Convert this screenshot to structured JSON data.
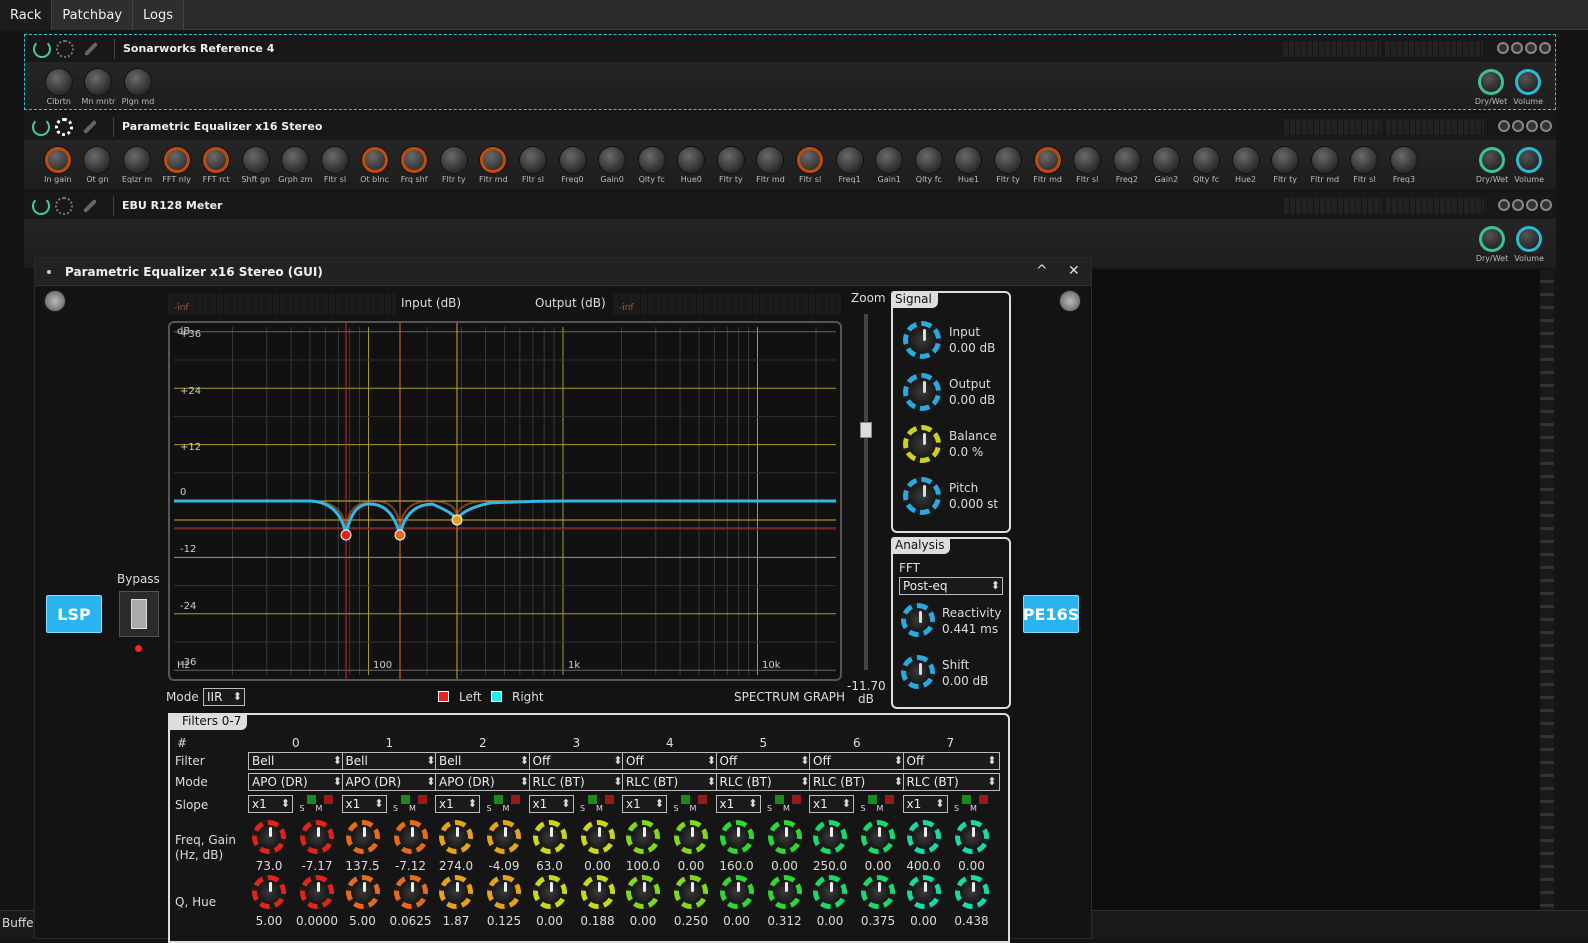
{
  "tabs": [
    "Rack",
    "Patchbay",
    "Logs"
  ],
  "plugins": [
    {
      "title": "Sonarworks Reference 4",
      "knobs": [
        "Clbrtn",
        "Mn mntr",
        "Plgn md"
      ]
    },
    {
      "title": "Parametric Equalizer x16 Stereo",
      "knobs": [
        "In gain",
        "Ot gn",
        "Eqlzr m",
        "FFT nly",
        "FFT rct",
        "Shft gn",
        "Grph zm",
        "Fltr sl",
        "Ot blnc",
        "Frq shf",
        "Fltr ty",
        "Fltr md",
        "Fltr sl",
        "Freq0",
        "Gain0",
        "Qlty fc",
        "Hue0",
        "Fltr ty",
        "Fltr md",
        "Fltr sl",
        "Freq1",
        "Gain1",
        "Qlty fc",
        "Hue1",
        "Fltr ty",
        "Fltr md",
        "Fltr sl",
        "Freq2",
        "Gain2",
        "Qlty fc",
        "Hue2",
        "Fltr ty",
        "Fltr md",
        "Fltr sl",
        "Freq3"
      ]
    },
    {
      "title": "EBU R128 Meter",
      "knobs": []
    }
  ],
  "right_knobs": [
    "Dry/Wet",
    "Volume"
  ],
  "gui": {
    "title": "Parametric Equalizer x16 Stereo (GUI)",
    "maximize": "^",
    "close": "✕",
    "lsp": "LSP",
    "bypass_label": "Bypass",
    "pe16s": "PE16S",
    "input_db": "Input (dB)",
    "output_db": "Output (dB)",
    "meter_inf": "-inf",
    "zoom": "Zoom",
    "zoom_value": "-11.70",
    "zoom_unit": "dB",
    "graph": {
      "y_labels": [
        "+36",
        "+24",
        "+12",
        "0",
        "-12",
        "-24",
        "-36"
      ],
      "db_unit": "dB",
      "hz_unit": "Hz",
      "x_labels": [
        "100",
        "1k",
        "10k"
      ]
    },
    "mode_label": "Mode",
    "mode_value": "IIR",
    "legend_left": "Left",
    "legend_right": "Right",
    "spectrum": "SPECTRUM GRAPH",
    "signal": {
      "tab": "Signal",
      "items": [
        {
          "name": "Input",
          "value": "0.00 dB"
        },
        {
          "name": "Output",
          "value": "0.00 dB"
        },
        {
          "name": "Balance",
          "value": "0.0 %"
        },
        {
          "name": "Pitch",
          "value": "0.000 st"
        }
      ]
    },
    "analysis": {
      "tab": "Analysis",
      "fft_label": "FFT",
      "fft_value": "Post-eq",
      "reactivity": "Reactivity",
      "reactivity_value": "0.441 ms",
      "shift": "Shift",
      "shift_value": "0.00 dB"
    },
    "filters": {
      "tab": "Filters 0-7",
      "row_hash": "#",
      "row_filter": "Filter",
      "row_mode": "Mode",
      "row_slope": "Slope",
      "row_freq": "Freq, Gain",
      "row_freq2": "(Hz, dB)",
      "row_q": "Q, Hue",
      "s": "S",
      "m": "M",
      "bands": [
        {
          "n": "0",
          "filter": "Bell",
          "mode": "APO (DR)",
          "slope": "x1",
          "freq": "73.0",
          "gain": "-7.17",
          "q": "5.00",
          "hue": "0.0000",
          "color": "#e0231b"
        },
        {
          "n": "1",
          "filter": "Bell",
          "mode": "APO (DR)",
          "slope": "x1",
          "freq": "137.5",
          "gain": "-7.12",
          "q": "5.00",
          "hue": "0.0625",
          "color": "#e76a1b"
        },
        {
          "n": "2",
          "filter": "Bell",
          "mode": "APO (DR)",
          "slope": "x1",
          "freq": "274.0",
          "gain": "-4.09",
          "q": "1.87",
          "hue": "0.125",
          "color": "#e6a21b"
        },
        {
          "n": "3",
          "filter": "Off",
          "mode": "RLC (BT)",
          "slope": "x1",
          "freq": "63.0",
          "gain": "0.00",
          "q": "0.00",
          "hue": "0.188",
          "color": "#c9d81b"
        },
        {
          "n": "4",
          "filter": "Off",
          "mode": "RLC (BT)",
          "slope": "x1",
          "freq": "100.0",
          "gain": "0.00",
          "q": "0.00",
          "hue": "0.250",
          "color": "#7ed81b"
        },
        {
          "n": "5",
          "filter": "Off",
          "mode": "RLC (BT)",
          "slope": "x1",
          "freq": "160.0",
          "gain": "0.00",
          "q": "0.00",
          "hue": "0.312",
          "color": "#2ed82e"
        },
        {
          "n": "6",
          "filter": "Off",
          "mode": "RLC (BT)",
          "slope": "x1",
          "freq": "250.0",
          "gain": "0.00",
          "q": "0.00",
          "hue": "0.375",
          "color": "#1bd86a"
        },
        {
          "n": "7",
          "filter": "Off",
          "mode": "RLC (BT)",
          "slope": "x1",
          "freq": "400.0",
          "gain": "0.00",
          "q": "0.00",
          "hue": "0.438",
          "color": "#1bd8a8"
        }
      ]
    }
  },
  "status": "Buffe"
}
